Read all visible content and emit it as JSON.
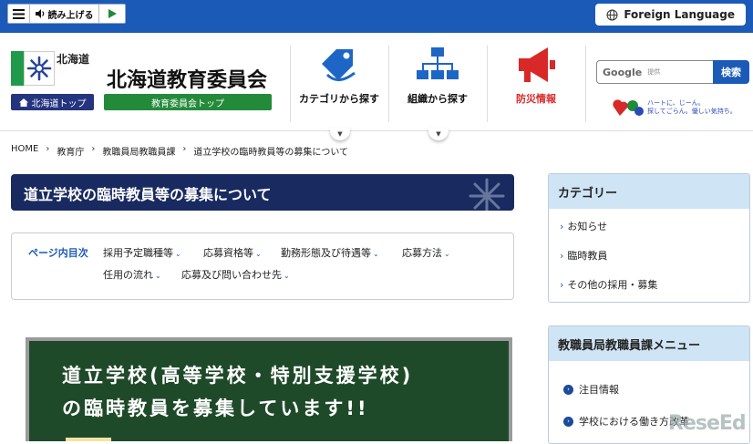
{
  "topbar": {
    "read_aloud_label": "読み上げる",
    "foreign_language_label": "Foreign Language"
  },
  "header": {
    "pref_name": "北海道",
    "pref_top_label": "北海道トップ",
    "site_title": "北海道教育委員会",
    "board_top_label": "教育委員会トップ",
    "nav": [
      {
        "label": "カテゴリから探す"
      },
      {
        "label": "組織から探す"
      },
      {
        "label": "防災情報"
      }
    ],
    "search": {
      "placeholder_brand": "Google",
      "placeholder_sub": "提供",
      "button_label": "検索"
    },
    "heart_text_1": "ハートに、じーん。",
    "heart_text_2": "探してごらん。優しい気持ち。"
  },
  "breadcrumb": [
    "HOME",
    "教育庁",
    "教職員局教職員課",
    "道立学校の臨時教員等の募集について"
  ],
  "page_title": "道立学校の臨時教員等の募集について",
  "toc": {
    "heading": "ページ内目次",
    "links": [
      "採用予定職種等",
      "応募資格等",
      "勤務形態及び待遇等",
      "応募方法",
      "任用の流れ",
      "応募及び問い合わせ先"
    ]
  },
  "banner": {
    "line1": "道立学校(高等学校・特別支援学校)",
    "line2": "の臨時教員を募集しています!!"
  },
  "sidebar": {
    "category": {
      "heading": "カテゴリー",
      "items": [
        "お知らせ",
        "臨時教員",
        "その他の採用・募集"
      ]
    },
    "menu": {
      "heading": "教職員局教職員課メニュー",
      "items": [
        "注目情報",
        "学校における働き方改革"
      ]
    }
  },
  "watermark": "ReseEd",
  "colors": {
    "top_bar": "#1b5bb7",
    "title_bar": "#182a5f",
    "green": "#238a3a",
    "nav_red": "#d82828"
  }
}
